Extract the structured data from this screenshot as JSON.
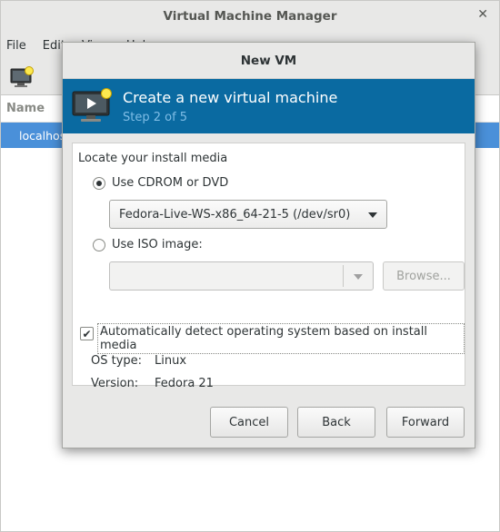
{
  "main_window": {
    "title": "Virtual Machine Manager",
    "close_glyph": "✕",
    "menu": [
      "File",
      "Edit",
      "View",
      "Help"
    ],
    "column_header": "Name",
    "connection": "localhost"
  },
  "dialog": {
    "title": "New VM",
    "banner": {
      "heading": "Create a new virtual machine",
      "step": "Step 2 of 5",
      "icon": "monitor-icon"
    },
    "locate_label": "Locate your install media",
    "cdrom": {
      "label": "Use CDROM or DVD",
      "selected": true,
      "device": "Fedora-Live-WS-x86_64-21-5 (/dev/sr0)"
    },
    "iso": {
      "label": "Use ISO image:",
      "selected": false,
      "value": "",
      "browse_label": "Browse..."
    },
    "autodetect": {
      "label": "Automatically detect operating system based on install media",
      "checked": true,
      "check_glyph": "✔"
    },
    "os_type": {
      "label": "OS type:",
      "value": "Linux"
    },
    "version": {
      "label": "Version:",
      "value": "Fedora 21"
    },
    "buttons": {
      "cancel": "Cancel",
      "back": "Back",
      "forward": "Forward"
    }
  },
  "colors": {
    "banner_bg": "#0a6aa1",
    "banner_step": "#7fbde6",
    "selection": "#4a90d9"
  }
}
